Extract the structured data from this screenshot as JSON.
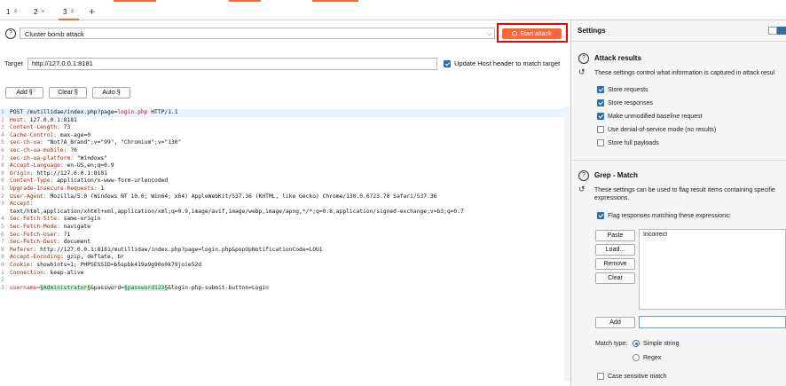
{
  "tabs": [
    {
      "label": "1",
      "close": "×"
    },
    {
      "label": "2",
      "close": "×"
    },
    {
      "label": "3",
      "close": "×"
    }
  ],
  "new_tab": "+",
  "attack": {
    "type_value": "Cluster bomb attack",
    "start_label": "Start attack",
    "accent": "#ff6633",
    "highlight": "#ee0000"
  },
  "target": {
    "label": "Target",
    "value": "http://127.0.0.1:8181",
    "update_host_label": "Update Host header to match target",
    "update_host_checked": true
  },
  "payload_buttons": {
    "add": "Add §",
    "clear": "Clear §",
    "auto": "Auto §"
  },
  "request_lines": [
    {
      "n": "1",
      "text": "POST /mutillidae/index.php?page=login.php HTTP/1.1"
    },
    {
      "n": "2",
      "text": "Host: 127.0.0.1:8181"
    },
    {
      "n": "3",
      "text": "Content-Length: 73"
    },
    {
      "n": "4",
      "text": "Cache-Control: max-age=0"
    },
    {
      "n": "5",
      "text": "sec-ch-ua: \"Not?A_Brand\";v=\"99\", \"Chromium\";v=\"130\""
    },
    {
      "n": "6",
      "text": "sec-ch-ua-mobile: ?0"
    },
    {
      "n": "7",
      "text": "sec-ch-ua-platform: \"Windows\""
    },
    {
      "n": "8",
      "text": "Accept-Language: en-US,en;q=0.9"
    },
    {
      "n": "9",
      "text": "Origin: http://127.0.0.1:8181"
    },
    {
      "n": "0",
      "text": "Content-Type: application/x-www-form-urlencoded"
    },
    {
      "n": "1",
      "text": "Upgrade-Insecure-Requests: 1"
    },
    {
      "n": "2",
      "text": "User-Agent: Mozilla/5.0 (Windows NT 10.0; Win64; x64) AppleWebKit/537.36 (KHTML, like Gecko) Chrome/130.0.6723.70 Safari/537.36"
    },
    {
      "n": "3",
      "text": "Accept:"
    },
    {
      "n": "",
      "text": "text/html,application/xhtml+xml,application/xml;q=0.9,image/avif,image/webp,image/apng,*/*;q=0.8,application/signed-exchange;v=b3;q=0.7"
    },
    {
      "n": "4",
      "text": "Sec-Fetch-Site: same-origin"
    },
    {
      "n": "5",
      "text": "Sec-Fetch-Mode: navigate"
    },
    {
      "n": "6",
      "text": "Sec-Fetch-User: ?1"
    },
    {
      "n": "7",
      "text": "Sec-Fetch-Dest: document"
    },
    {
      "n": "8",
      "text": "Referer: http://127.0.0.1:8181/mutillidae/index.php?page=login.php&popUpNotificationCode=LOU1"
    },
    {
      "n": "9",
      "text": "Accept-Encoding: gzip, deflate, br"
    },
    {
      "n": "0",
      "text": "Cookie: showhints=1; PHPSESSID=b5spbk419a9g90o0k79joie52d"
    },
    {
      "n": "1",
      "text": "Connection: keep-alive"
    },
    {
      "n": "2",
      "text": ""
    },
    {
      "n": "3",
      "text": "username=§Administrator§&password=§password123§&login-php-submit-button=Login"
    }
  ],
  "settings": {
    "title": "Settings",
    "attack_results": {
      "title": "Attack results",
      "desc": "These settings control what information is captured in attack resul",
      "options": [
        {
          "label": "Store requests",
          "checked": true
        },
        {
          "label": "Store responses",
          "checked": true
        },
        {
          "label": "Make unmodified baseline request",
          "checked": true
        },
        {
          "label": "Use denial-of-service mode (no results)",
          "checked": false
        },
        {
          "label": "Store full payloads",
          "checked": false
        }
      ]
    },
    "grep_match": {
      "title": "Grep - Match",
      "desc": "These settings can be used to flag result items containing specifie expressions.",
      "flag_label": "Flag responses matching these expressions:",
      "flag_checked": true,
      "buttons": {
        "paste": "Paste",
        "load": "Load...",
        "remove": "Remove",
        "clear": "Clear"
      },
      "items": [
        "Incorrect"
      ],
      "add_label": "Add",
      "match_type_label": "Match type:",
      "match_types": [
        {
          "label": "Simple string",
          "selected": true
        },
        {
          "label": "Regex",
          "selected": false
        }
      ],
      "case_sensitive_label": "Case sensitive match",
      "case_sensitive_checked": false
    }
  },
  "icons": {
    "help": "?",
    "reset": "↺",
    "chevron": "⌵"
  }
}
